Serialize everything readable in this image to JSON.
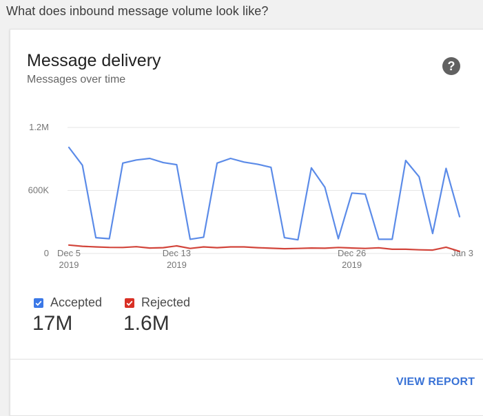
{
  "question": "What does inbound message volume look like?",
  "card": {
    "title": "Message delivery",
    "subtitle": "Messages over time",
    "help_icon": "help-circle-icon",
    "view_report": "VIEW REPORT"
  },
  "legend": [
    {
      "label": "Accepted",
      "total": "17M",
      "color": "#3b78e7"
    },
    {
      "label": "Rejected",
      "total": "1.6M",
      "color": "#d93025"
    }
  ],
  "colors": {
    "accepted": "#5b8be8",
    "rejected": "#d2443a",
    "link": "#3a73d6"
  },
  "chart_data": {
    "type": "line",
    "title": "",
    "xlabel": "",
    "ylabel": "",
    "ylim": [
      0,
      1200000
    ],
    "y_ticks": [
      "0",
      "600K",
      "1.2M"
    ],
    "y_tick_values": [
      0,
      600000,
      1200000
    ],
    "x_ticks": [
      {
        "index": 0,
        "label": "Dec 5",
        "sublabel": "2019"
      },
      {
        "index": 8,
        "label": "Dec 13",
        "sublabel": "2019"
      },
      {
        "index": 21,
        "label": "Dec 26",
        "sublabel": "2019"
      },
      {
        "index": 29,
        "label": "Jan 3",
        "sublabel": ""
      }
    ],
    "x": [
      "2019-12-05",
      "2019-12-06",
      "2019-12-07",
      "2019-12-08",
      "2019-12-09",
      "2019-12-10",
      "2019-12-11",
      "2019-12-12",
      "2019-12-13",
      "2019-12-14",
      "2019-12-15",
      "2019-12-16",
      "2019-12-17",
      "2019-12-18",
      "2019-12-19",
      "2019-12-20",
      "2019-12-21",
      "2019-12-22",
      "2019-12-23",
      "2019-12-24",
      "2019-12-25",
      "2019-12-26",
      "2019-12-27",
      "2019-12-28",
      "2019-12-29",
      "2019-12-30",
      "2019-12-31",
      "2020-01-01",
      "2020-01-02",
      "2020-01-03"
    ],
    "series": [
      {
        "name": "Accepted",
        "color": "#5b8be8",
        "values": [
          1010000,
          840000,
          150000,
          140000,
          860000,
          890000,
          905000,
          865000,
          845000,
          135000,
          155000,
          860000,
          905000,
          870000,
          850000,
          820000,
          150000,
          130000,
          815000,
          630000,
          140000,
          575000,
          565000,
          135000,
          135000,
          885000,
          730000,
          190000,
          810000,
          350000
        ]
      },
      {
        "name": "Rejected",
        "color": "#d2443a",
        "values": [
          80000,
          68000,
          62000,
          58000,
          57000,
          64000,
          52000,
          55000,
          72000,
          48000,
          62000,
          55000,
          62000,
          62000,
          55000,
          50000,
          45000,
          48000,
          52000,
          50000,
          57000,
          52000,
          48000,
          54000,
          40000,
          40000,
          35000,
          32000,
          60000,
          20000
        ]
      }
    ],
    "grid": true,
    "legend_position": "bottom-left"
  }
}
